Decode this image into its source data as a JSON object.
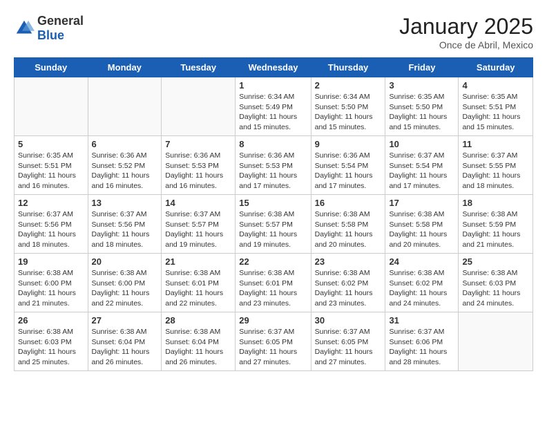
{
  "header": {
    "logo": {
      "general": "General",
      "blue": "Blue"
    },
    "title": "January 2025",
    "location": "Once de Abril, Mexico"
  },
  "weekdays": [
    "Sunday",
    "Monday",
    "Tuesday",
    "Wednesday",
    "Thursday",
    "Friday",
    "Saturday"
  ],
  "weeks": [
    [
      {
        "day": "",
        "info": ""
      },
      {
        "day": "",
        "info": ""
      },
      {
        "day": "",
        "info": ""
      },
      {
        "day": "1",
        "info": "Sunrise: 6:34 AM\nSunset: 5:49 PM\nDaylight: 11 hours\nand 15 minutes."
      },
      {
        "day": "2",
        "info": "Sunrise: 6:34 AM\nSunset: 5:50 PM\nDaylight: 11 hours\nand 15 minutes."
      },
      {
        "day": "3",
        "info": "Sunrise: 6:35 AM\nSunset: 5:50 PM\nDaylight: 11 hours\nand 15 minutes."
      },
      {
        "day": "4",
        "info": "Sunrise: 6:35 AM\nSunset: 5:51 PM\nDaylight: 11 hours\nand 15 minutes."
      }
    ],
    [
      {
        "day": "5",
        "info": "Sunrise: 6:35 AM\nSunset: 5:51 PM\nDaylight: 11 hours\nand 16 minutes."
      },
      {
        "day": "6",
        "info": "Sunrise: 6:36 AM\nSunset: 5:52 PM\nDaylight: 11 hours\nand 16 minutes."
      },
      {
        "day": "7",
        "info": "Sunrise: 6:36 AM\nSunset: 5:53 PM\nDaylight: 11 hours\nand 16 minutes."
      },
      {
        "day": "8",
        "info": "Sunrise: 6:36 AM\nSunset: 5:53 PM\nDaylight: 11 hours\nand 17 minutes."
      },
      {
        "day": "9",
        "info": "Sunrise: 6:36 AM\nSunset: 5:54 PM\nDaylight: 11 hours\nand 17 minutes."
      },
      {
        "day": "10",
        "info": "Sunrise: 6:37 AM\nSunset: 5:54 PM\nDaylight: 11 hours\nand 17 minutes."
      },
      {
        "day": "11",
        "info": "Sunrise: 6:37 AM\nSunset: 5:55 PM\nDaylight: 11 hours\nand 18 minutes."
      }
    ],
    [
      {
        "day": "12",
        "info": "Sunrise: 6:37 AM\nSunset: 5:56 PM\nDaylight: 11 hours\nand 18 minutes."
      },
      {
        "day": "13",
        "info": "Sunrise: 6:37 AM\nSunset: 5:56 PM\nDaylight: 11 hours\nand 18 minutes."
      },
      {
        "day": "14",
        "info": "Sunrise: 6:37 AM\nSunset: 5:57 PM\nDaylight: 11 hours\nand 19 minutes."
      },
      {
        "day": "15",
        "info": "Sunrise: 6:38 AM\nSunset: 5:57 PM\nDaylight: 11 hours\nand 19 minutes."
      },
      {
        "day": "16",
        "info": "Sunrise: 6:38 AM\nSunset: 5:58 PM\nDaylight: 11 hours\nand 20 minutes."
      },
      {
        "day": "17",
        "info": "Sunrise: 6:38 AM\nSunset: 5:58 PM\nDaylight: 11 hours\nand 20 minutes."
      },
      {
        "day": "18",
        "info": "Sunrise: 6:38 AM\nSunset: 5:59 PM\nDaylight: 11 hours\nand 21 minutes."
      }
    ],
    [
      {
        "day": "19",
        "info": "Sunrise: 6:38 AM\nSunset: 6:00 PM\nDaylight: 11 hours\nand 21 minutes."
      },
      {
        "day": "20",
        "info": "Sunrise: 6:38 AM\nSunset: 6:00 PM\nDaylight: 11 hours\nand 22 minutes."
      },
      {
        "day": "21",
        "info": "Sunrise: 6:38 AM\nSunset: 6:01 PM\nDaylight: 11 hours\nand 22 minutes."
      },
      {
        "day": "22",
        "info": "Sunrise: 6:38 AM\nSunset: 6:01 PM\nDaylight: 11 hours\nand 23 minutes."
      },
      {
        "day": "23",
        "info": "Sunrise: 6:38 AM\nSunset: 6:02 PM\nDaylight: 11 hours\nand 23 minutes."
      },
      {
        "day": "24",
        "info": "Sunrise: 6:38 AM\nSunset: 6:02 PM\nDaylight: 11 hours\nand 24 minutes."
      },
      {
        "day": "25",
        "info": "Sunrise: 6:38 AM\nSunset: 6:03 PM\nDaylight: 11 hours\nand 24 minutes."
      }
    ],
    [
      {
        "day": "26",
        "info": "Sunrise: 6:38 AM\nSunset: 6:03 PM\nDaylight: 11 hours\nand 25 minutes."
      },
      {
        "day": "27",
        "info": "Sunrise: 6:38 AM\nSunset: 6:04 PM\nDaylight: 11 hours\nand 26 minutes."
      },
      {
        "day": "28",
        "info": "Sunrise: 6:38 AM\nSunset: 6:04 PM\nDaylight: 11 hours\nand 26 minutes."
      },
      {
        "day": "29",
        "info": "Sunrise: 6:37 AM\nSunset: 6:05 PM\nDaylight: 11 hours\nand 27 minutes."
      },
      {
        "day": "30",
        "info": "Sunrise: 6:37 AM\nSunset: 6:05 PM\nDaylight: 11 hours\nand 27 minutes."
      },
      {
        "day": "31",
        "info": "Sunrise: 6:37 AM\nSunset: 6:06 PM\nDaylight: 11 hours\nand 28 minutes."
      },
      {
        "day": "",
        "info": ""
      }
    ]
  ]
}
